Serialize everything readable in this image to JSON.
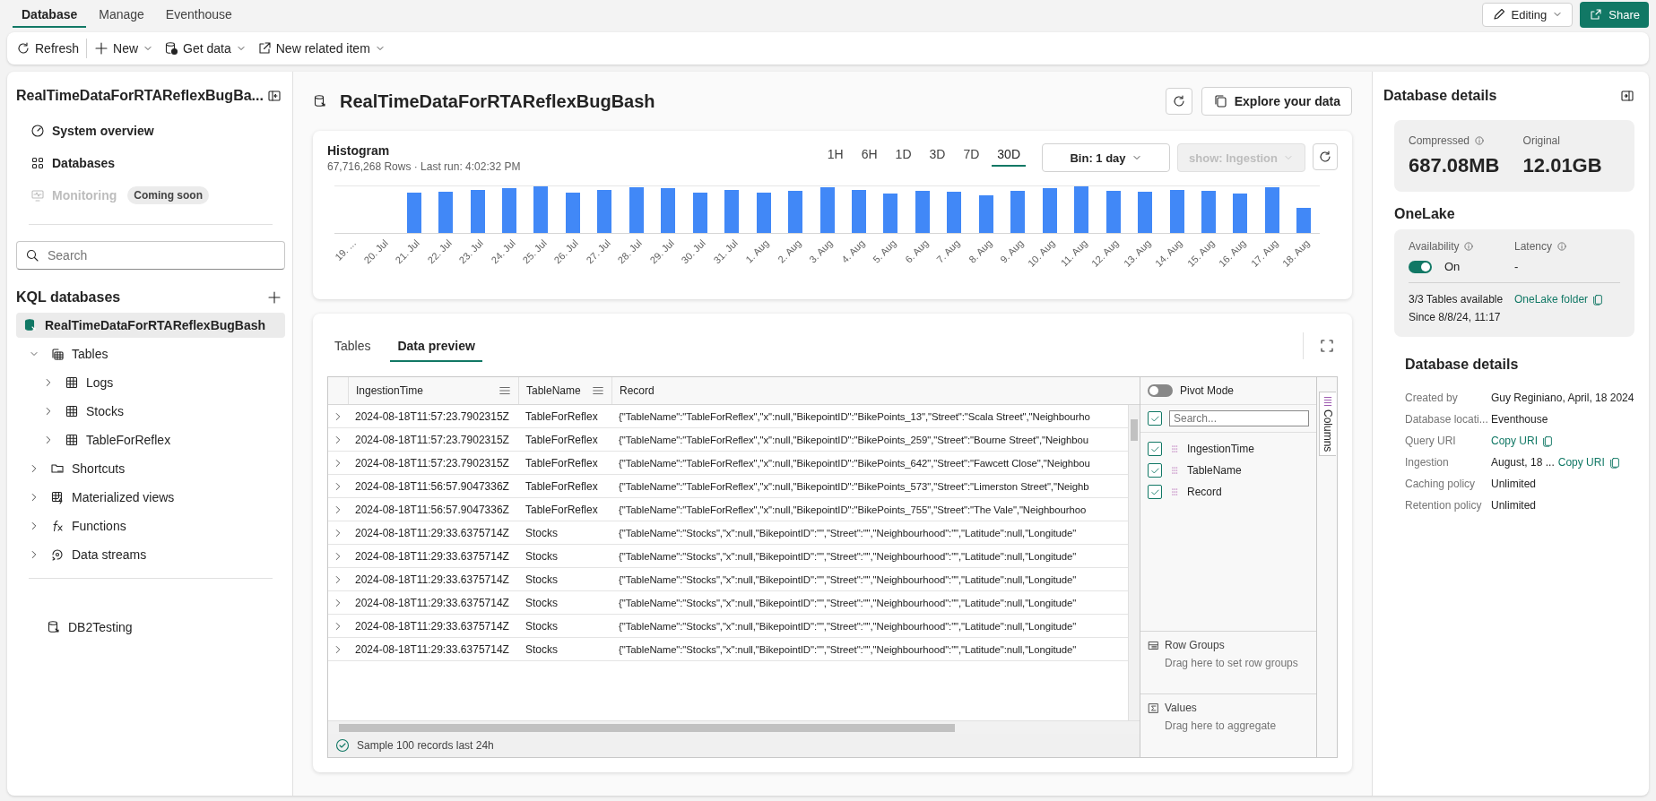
{
  "ribbon_tabs": [
    {
      "label": "Database",
      "selected": true
    },
    {
      "label": "Manage",
      "selected": false
    },
    {
      "label": "Eventhouse",
      "selected": false
    }
  ],
  "header_buttons": {
    "editing": "Editing",
    "share": "Share"
  },
  "toolbar": [
    {
      "label": "Refresh",
      "kind": "refresh",
      "dropdown": false
    },
    {
      "label": "New",
      "kind": "new",
      "dropdown": true
    },
    {
      "label": "Get data",
      "kind": "getdata",
      "dropdown": true
    },
    {
      "label": "New related item",
      "kind": "related",
      "dropdown": true
    }
  ],
  "sidebar": {
    "title": "RealTimeDataForRTAReflexBugBa...",
    "nav": [
      {
        "label": "System overview",
        "kind": "overview",
        "disabled": false
      },
      {
        "label": "Databases",
        "kind": "databases",
        "disabled": false
      },
      {
        "label": "Monitoring",
        "kind": "monitoring",
        "disabled": true,
        "badge": "Coming soon"
      }
    ],
    "search": {
      "placeholder": "Search"
    },
    "section_title": "KQL databases",
    "tree": [
      {
        "label": "RealTimeDataForRTAReflexBugBash",
        "kind": "database",
        "selected": true,
        "children": [
          {
            "label": "Tables",
            "kind": "tables",
            "expanded": true,
            "children": [
              {
                "label": "Logs",
                "kind": "table",
                "expanded": false
              },
              {
                "label": "Stocks",
                "kind": "table",
                "expanded": false
              },
              {
                "label": "TableForReflex",
                "kind": "table",
                "expanded": false
              }
            ]
          },
          {
            "label": "Shortcuts",
            "kind": "shortcuts",
            "expanded": false
          },
          {
            "label": "Materialized views",
            "kind": "views",
            "expanded": false
          },
          {
            "label": "Functions",
            "kind": "functions",
            "expanded": false
          },
          {
            "label": "Data streams",
            "kind": "streams",
            "expanded": false
          }
        ]
      }
    ],
    "other_databases": [
      {
        "label": "DB2Testing",
        "selected": false
      }
    ]
  },
  "main": {
    "title": "RealTimeDataForRTAReflexBugBash",
    "explore_button": "Explore your data",
    "histogram": {
      "title": "Histogram",
      "subtitle": "67,716,268 Rows · Last run: 4:02:32 PM",
      "ranges": [
        {
          "label": "1H",
          "selected": false
        },
        {
          "label": "6H",
          "selected": false
        },
        {
          "label": "1D",
          "selected": false
        },
        {
          "label": "3D",
          "selected": false
        },
        {
          "label": "7D",
          "selected": false
        },
        {
          "label": "30D",
          "selected": true
        }
      ],
      "bin": "Bin: 1 day",
      "show": {
        "label": "show: Ingestion",
        "disabled": true
      },
      "x_labels": [
        "19. ...",
        "20. Jul",
        "21. Jul",
        "22. Jul",
        "23. Jul",
        "24. Jul",
        "25. Jul",
        "26. Jul",
        "27. Jul",
        "28. Jul",
        "29. Jul",
        "30. Jul",
        "31. Jul",
        "1. Aug",
        "2. Aug",
        "3. Aug",
        "4. Aug",
        "5. Aug",
        "6. Aug",
        "7. Aug",
        "8. Aug",
        "9. Aug",
        "10. Aug",
        "11. Aug",
        "12. Aug",
        "13. Aug",
        "14. Aug",
        "15. Aug",
        "16. Aug",
        "17. Aug",
        "18. Aug"
      ]
    },
    "data_tabs": [
      {
        "label": "Tables",
        "selected": false
      },
      {
        "label": "Data preview",
        "selected": true
      }
    ],
    "grid": {
      "columns": [
        "IngestionTime",
        "TableName",
        "Record"
      ],
      "rows": [
        [
          "2024-08-18T11:57:23.7902315Z",
          "TableForReflex",
          "{\"TableName\":\"TableForReflex\",\"x\":null,\"BikepointID\":\"BikePoints_13\",\"Street\":\"Scala Street\",\"Neighbourho"
        ],
        [
          "2024-08-18T11:57:23.7902315Z",
          "TableForReflex",
          "{\"TableName\":\"TableForReflex\",\"x\":null,\"BikepointID\":\"BikePoints_259\",\"Street\":\"Bourne Street\",\"Neighbou"
        ],
        [
          "2024-08-18T11:57:23.7902315Z",
          "TableForReflex",
          "{\"TableName\":\"TableForReflex\",\"x\":null,\"BikepointID\":\"BikePoints_642\",\"Street\":\"Fawcett Close\",\"Neighbou"
        ],
        [
          "2024-08-18T11:56:57.9047336Z",
          "TableForReflex",
          "{\"TableName\":\"TableForReflex\",\"x\":null,\"BikepointID\":\"BikePoints_573\",\"Street\":\"Limerston Street\",\"Neighb"
        ],
        [
          "2024-08-18T11:56:57.9047336Z",
          "TableForReflex",
          "{\"TableName\":\"TableForReflex\",\"x\":null,\"BikepointID\":\"BikePoints_755\",\"Street\":\"The Vale\",\"Neighbourhoo"
        ],
        [
          "2024-08-18T11:29:33.6375714Z",
          "Stocks",
          "{\"TableName\":\"Stocks\",\"x\":null,\"BikepointID\":\"\",\"Street\":\"\",\"Neighbourhood\":\"\",\"Latitude\":null,\"Longitude\""
        ],
        [
          "2024-08-18T11:29:33.6375714Z",
          "Stocks",
          "{\"TableName\":\"Stocks\",\"x\":null,\"BikepointID\":\"\",\"Street\":\"\",\"Neighbourhood\":\"\",\"Latitude\":null,\"Longitude\""
        ],
        [
          "2024-08-18T11:29:33.6375714Z",
          "Stocks",
          "{\"TableName\":\"Stocks\",\"x\":null,\"BikepointID\":\"\",\"Street\":\"\",\"Neighbourhood\":\"\",\"Latitude\":null,\"Longitude\""
        ],
        [
          "2024-08-18T11:29:33.6375714Z",
          "Stocks",
          "{\"TableName\":\"Stocks\",\"x\":null,\"BikepointID\":\"\",\"Street\":\"\",\"Neighbourhood\":\"\",\"Latitude\":null,\"Longitude\""
        ],
        [
          "2024-08-18T11:29:33.6375714Z",
          "Stocks",
          "{\"TableName\":\"Stocks\",\"x\":null,\"BikepointID\":\"\",\"Street\":\"\",\"Neighbourhood\":\"\",\"Latitude\":null,\"Longitude\""
        ],
        [
          "2024-08-18T11:29:33.6375714Z",
          "Stocks",
          "{\"TableName\":\"Stocks\",\"x\":null,\"BikepointID\":\"\",\"Street\":\"\",\"Neighbourhood\":\"\",\"Latitude\":null,\"Longitude\""
        ]
      ],
      "footer": "Sample 100 records last 24h",
      "pivot": {
        "pivot_mode": {
          "label": "Pivot Mode",
          "on": false
        },
        "search": {
          "placeholder": "Search..."
        },
        "select_all": {
          "checked": true
        },
        "columns": [
          {
            "label": "IngestionTime",
            "checked": true
          },
          {
            "label": "TableName",
            "checked": true
          },
          {
            "label": "Record",
            "checked": true
          }
        ],
        "row_groups": {
          "title": "Row Groups",
          "hint": "Drag here to set row groups"
        },
        "values": {
          "title": "Values",
          "hint": "Drag here to aggregate"
        },
        "side_tab": "Columns"
      }
    }
  },
  "details": {
    "title": "Database details",
    "sizes": [
      {
        "label": "Compressed",
        "value": "687.08MB",
        "info": true
      },
      {
        "label": "Original",
        "value": "12.01GB",
        "info": false
      }
    ],
    "onelake": {
      "title": "OneLake",
      "availability": {
        "label": "Availability",
        "on": true,
        "state": "On"
      },
      "latency": {
        "label": "Latency",
        "value": "-"
      },
      "tables": "3/3 Tables available",
      "since": "Since 8/8/24, 11:17",
      "link": "OneLake folder"
    },
    "section_title": "Database details",
    "rows": [
      {
        "label": "Created by",
        "value": "Guy Reginiano, April, 18 2024"
      },
      {
        "label": "Database locati...",
        "value": "Eventhouse"
      },
      {
        "label": "Query URI",
        "link": "Copy URI"
      },
      {
        "label": "Ingestion",
        "value": "August, 18 ...",
        "link": "Copy URI"
      },
      {
        "label": "Caching policy",
        "value": "Unlimited"
      },
      {
        "label": "Retention policy",
        "value": "Unlimited"
      }
    ]
  }
}
